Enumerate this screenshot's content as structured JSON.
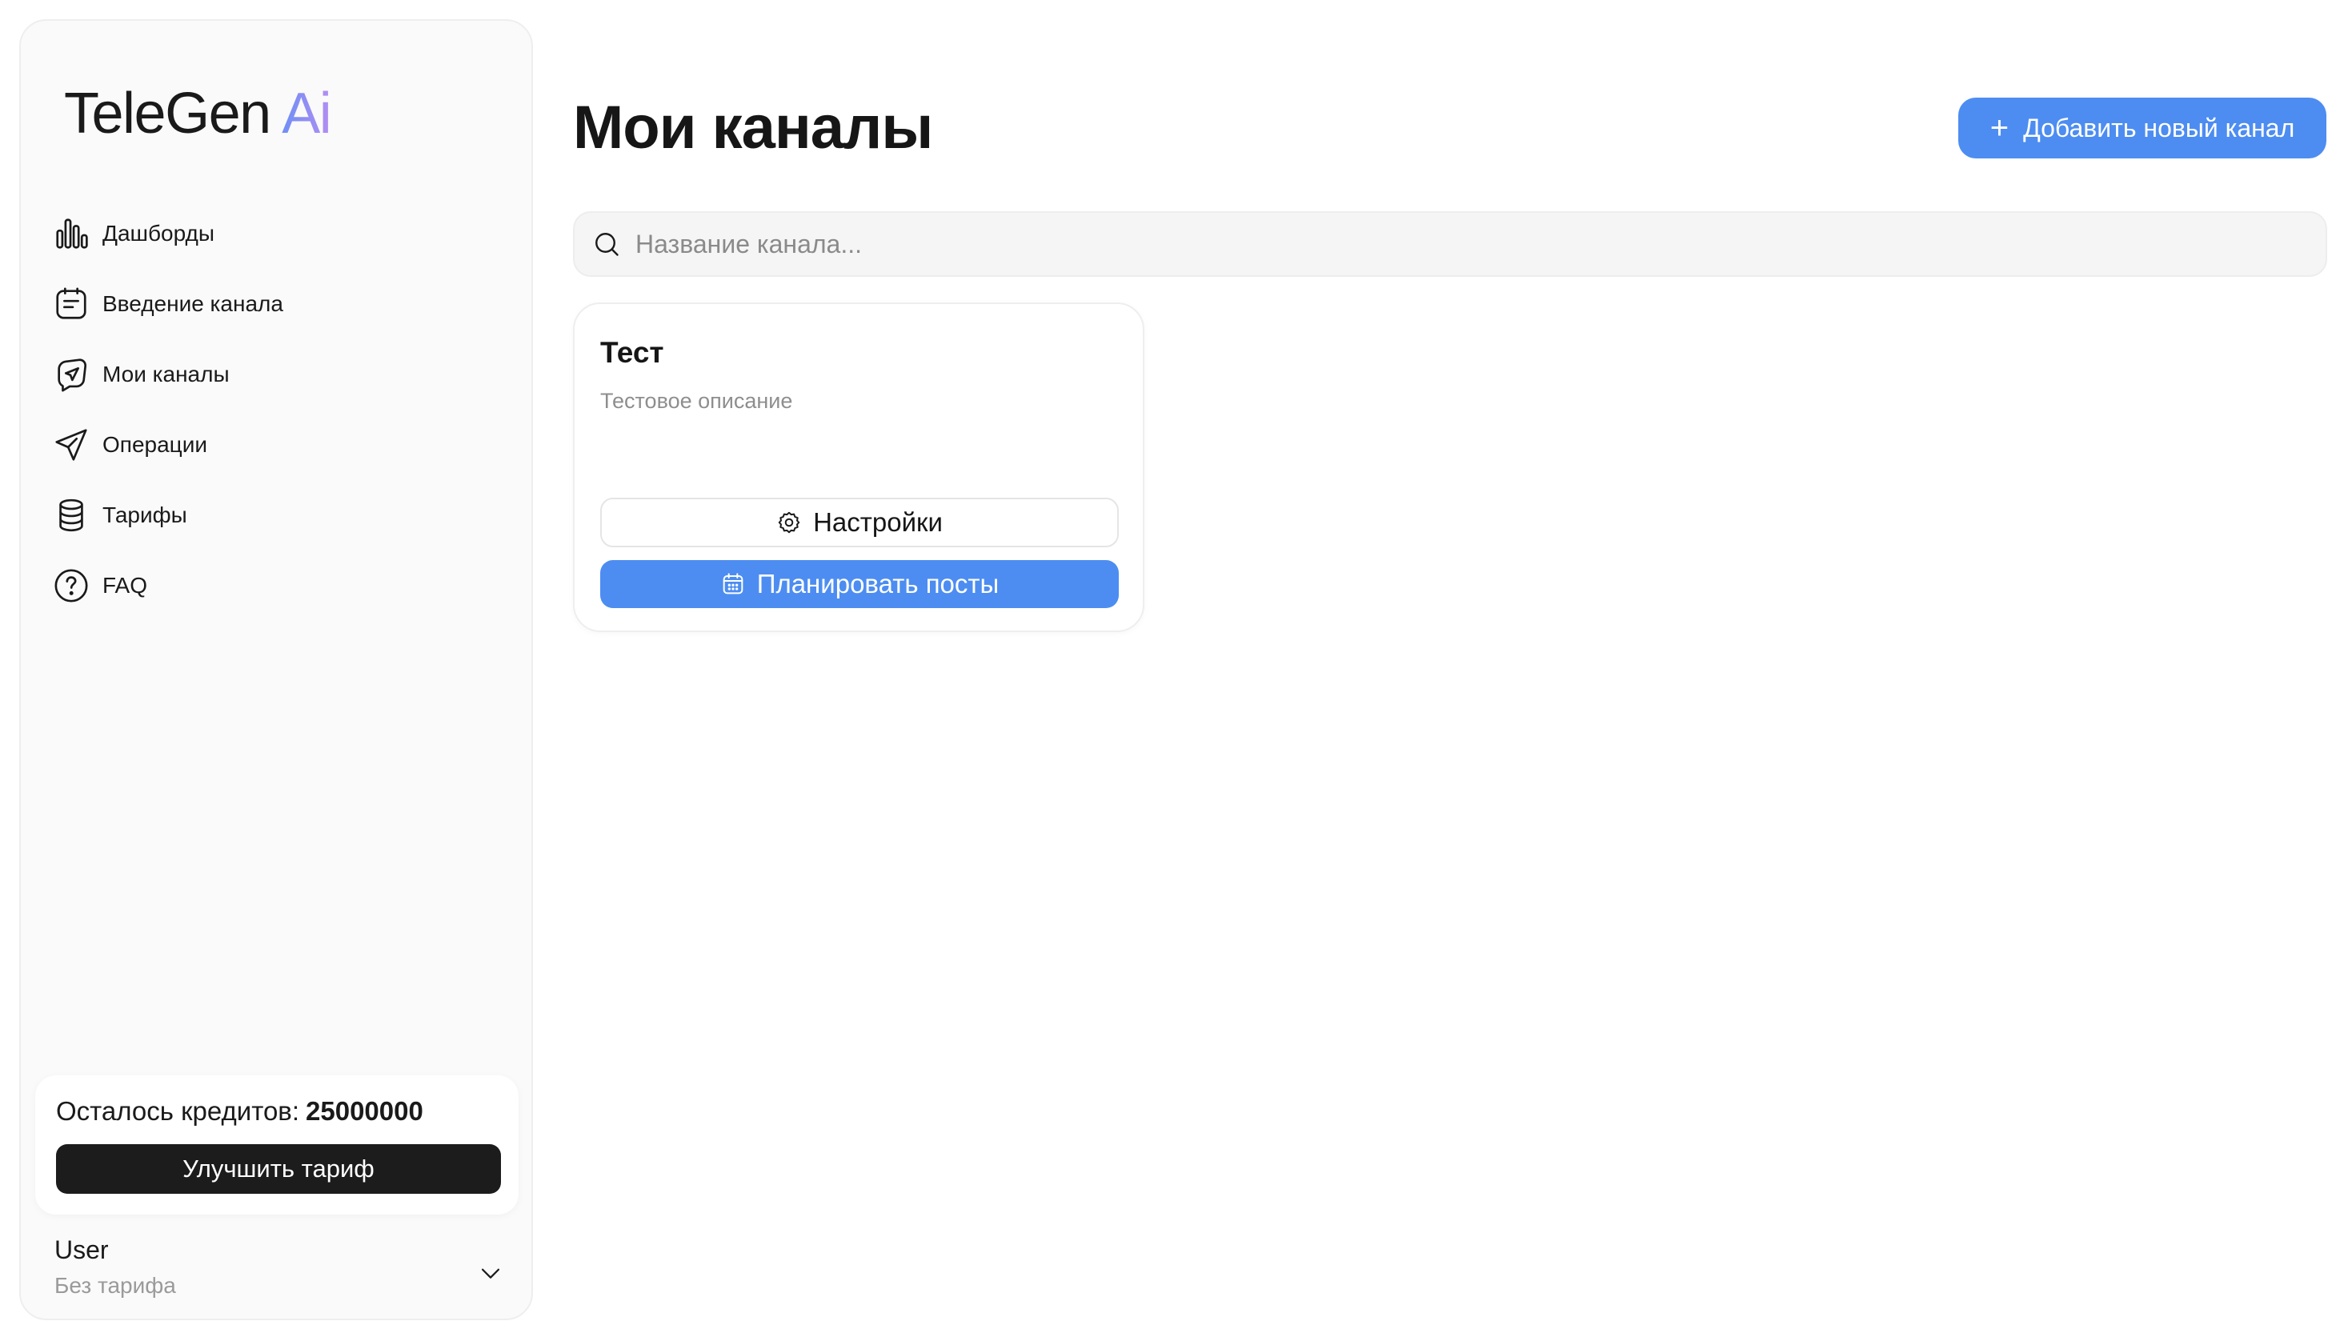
{
  "brand": {
    "name": "TeleGen",
    "suffix": "Ai"
  },
  "sidebar": {
    "items": [
      {
        "label": "Дашборды",
        "icon": "bar-chart-icon"
      },
      {
        "label": "Введение канала",
        "icon": "document-icon"
      },
      {
        "label": "Мои каналы",
        "icon": "telegram-icon"
      },
      {
        "label": "Операции",
        "icon": "paper-plane-icon"
      },
      {
        "label": "Тарифы",
        "icon": "coins-icon"
      },
      {
        "label": "FAQ",
        "icon": "question-circle-icon"
      }
    ]
  },
  "credits": {
    "label": "Осталось кредитов:",
    "amount": "25000000",
    "upgrade_label": "Улучшить тариф"
  },
  "user": {
    "name": "User",
    "plan": "Без тарифа"
  },
  "main": {
    "title": "Мои каналы",
    "add_button": {
      "plus": "+",
      "label": "Добавить новый канал"
    },
    "search": {
      "placeholder": "Название канала...",
      "value": ""
    },
    "channels": [
      {
        "title": "Тест",
        "description": "Тестовое описание",
        "settings_label": "Настройки",
        "schedule_label": "Планировать посты"
      }
    ]
  },
  "colors": {
    "accent": "#4d8df1",
    "dark_button": "#1c1c1c",
    "sidebar_bg": "#fafafa",
    "muted_text": "#8e8e8e"
  }
}
